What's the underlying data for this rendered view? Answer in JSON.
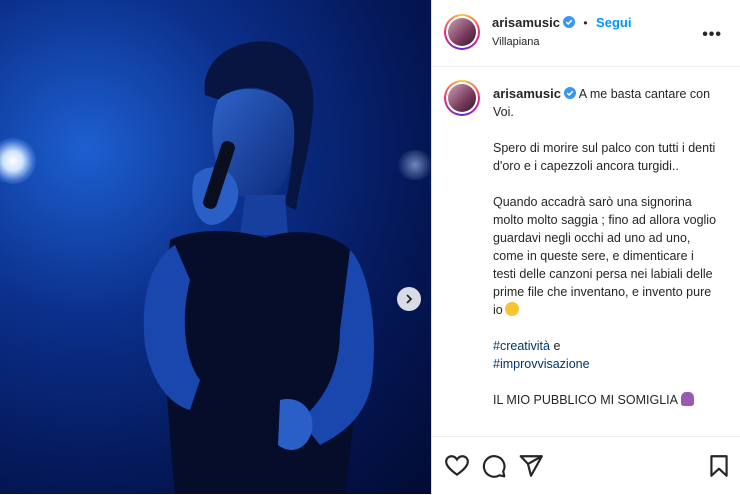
{
  "post": {
    "username": "arisamusic",
    "location": "Villapiana",
    "follow_label": "Segui",
    "dot": "•",
    "more": "•••",
    "caption": {
      "line1": "A me basta cantare con Voi.",
      "para2": "Spero di morire sul palco con tutti i denti d'oro e i capezzoli ancora turgidi..",
      "para3": "Quando accadrà sarò una signorina molto molto saggia ; fino ad allora voglio guardavi negli occhi ad uno ad uno, come in queste sere, e dimenticare i testi delle canzoni persa nei labiali delle prime file che inventano, e invento pure io",
      "hashtag1": "#creatività",
      "joiner": " e",
      "hashtag2": "#improvvisazione",
      "closing": "IL MIO PUBBLICO MI SOMIGLIA"
    }
  },
  "colors": {
    "accent": "#0095f6",
    "verified": "#3897f0",
    "hashtag": "#00376b"
  },
  "icons": [
    "heart-icon",
    "comment-icon",
    "share-icon",
    "bookmark-icon",
    "chevron-right-icon",
    "verified-badge-icon",
    "more-options-icon"
  ]
}
